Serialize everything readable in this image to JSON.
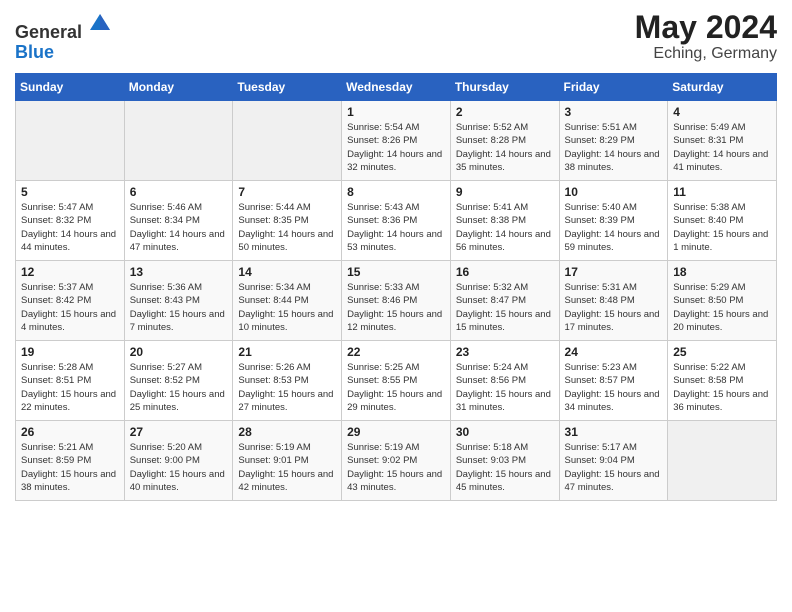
{
  "header": {
    "logo_general": "General",
    "logo_blue": "Blue",
    "month_year": "May 2024",
    "location": "Eching, Germany"
  },
  "days_of_week": [
    "Sunday",
    "Monday",
    "Tuesday",
    "Wednesday",
    "Thursday",
    "Friday",
    "Saturday"
  ],
  "weeks": [
    [
      {
        "day": "",
        "info": ""
      },
      {
        "day": "",
        "info": ""
      },
      {
        "day": "",
        "info": ""
      },
      {
        "day": "1",
        "info": "Sunrise: 5:54 AM\nSunset: 8:26 PM\nDaylight: 14 hours\nand 32 minutes."
      },
      {
        "day": "2",
        "info": "Sunrise: 5:52 AM\nSunset: 8:28 PM\nDaylight: 14 hours\nand 35 minutes."
      },
      {
        "day": "3",
        "info": "Sunrise: 5:51 AM\nSunset: 8:29 PM\nDaylight: 14 hours\nand 38 minutes."
      },
      {
        "day": "4",
        "info": "Sunrise: 5:49 AM\nSunset: 8:31 PM\nDaylight: 14 hours\nand 41 minutes."
      }
    ],
    [
      {
        "day": "5",
        "info": "Sunrise: 5:47 AM\nSunset: 8:32 PM\nDaylight: 14 hours\nand 44 minutes."
      },
      {
        "day": "6",
        "info": "Sunrise: 5:46 AM\nSunset: 8:34 PM\nDaylight: 14 hours\nand 47 minutes."
      },
      {
        "day": "7",
        "info": "Sunrise: 5:44 AM\nSunset: 8:35 PM\nDaylight: 14 hours\nand 50 minutes."
      },
      {
        "day": "8",
        "info": "Sunrise: 5:43 AM\nSunset: 8:36 PM\nDaylight: 14 hours\nand 53 minutes."
      },
      {
        "day": "9",
        "info": "Sunrise: 5:41 AM\nSunset: 8:38 PM\nDaylight: 14 hours\nand 56 minutes."
      },
      {
        "day": "10",
        "info": "Sunrise: 5:40 AM\nSunset: 8:39 PM\nDaylight: 14 hours\nand 59 minutes."
      },
      {
        "day": "11",
        "info": "Sunrise: 5:38 AM\nSunset: 8:40 PM\nDaylight: 15 hours\nand 1 minute."
      }
    ],
    [
      {
        "day": "12",
        "info": "Sunrise: 5:37 AM\nSunset: 8:42 PM\nDaylight: 15 hours\nand 4 minutes."
      },
      {
        "day": "13",
        "info": "Sunrise: 5:36 AM\nSunset: 8:43 PM\nDaylight: 15 hours\nand 7 minutes."
      },
      {
        "day": "14",
        "info": "Sunrise: 5:34 AM\nSunset: 8:44 PM\nDaylight: 15 hours\nand 10 minutes."
      },
      {
        "day": "15",
        "info": "Sunrise: 5:33 AM\nSunset: 8:46 PM\nDaylight: 15 hours\nand 12 minutes."
      },
      {
        "day": "16",
        "info": "Sunrise: 5:32 AM\nSunset: 8:47 PM\nDaylight: 15 hours\nand 15 minutes."
      },
      {
        "day": "17",
        "info": "Sunrise: 5:31 AM\nSunset: 8:48 PM\nDaylight: 15 hours\nand 17 minutes."
      },
      {
        "day": "18",
        "info": "Sunrise: 5:29 AM\nSunset: 8:50 PM\nDaylight: 15 hours\nand 20 minutes."
      }
    ],
    [
      {
        "day": "19",
        "info": "Sunrise: 5:28 AM\nSunset: 8:51 PM\nDaylight: 15 hours\nand 22 minutes."
      },
      {
        "day": "20",
        "info": "Sunrise: 5:27 AM\nSunset: 8:52 PM\nDaylight: 15 hours\nand 25 minutes."
      },
      {
        "day": "21",
        "info": "Sunrise: 5:26 AM\nSunset: 8:53 PM\nDaylight: 15 hours\nand 27 minutes."
      },
      {
        "day": "22",
        "info": "Sunrise: 5:25 AM\nSunset: 8:55 PM\nDaylight: 15 hours\nand 29 minutes."
      },
      {
        "day": "23",
        "info": "Sunrise: 5:24 AM\nSunset: 8:56 PM\nDaylight: 15 hours\nand 31 minutes."
      },
      {
        "day": "24",
        "info": "Sunrise: 5:23 AM\nSunset: 8:57 PM\nDaylight: 15 hours\nand 34 minutes."
      },
      {
        "day": "25",
        "info": "Sunrise: 5:22 AM\nSunset: 8:58 PM\nDaylight: 15 hours\nand 36 minutes."
      }
    ],
    [
      {
        "day": "26",
        "info": "Sunrise: 5:21 AM\nSunset: 8:59 PM\nDaylight: 15 hours\nand 38 minutes."
      },
      {
        "day": "27",
        "info": "Sunrise: 5:20 AM\nSunset: 9:00 PM\nDaylight: 15 hours\nand 40 minutes."
      },
      {
        "day": "28",
        "info": "Sunrise: 5:19 AM\nSunset: 9:01 PM\nDaylight: 15 hours\nand 42 minutes."
      },
      {
        "day": "29",
        "info": "Sunrise: 5:19 AM\nSunset: 9:02 PM\nDaylight: 15 hours\nand 43 minutes."
      },
      {
        "day": "30",
        "info": "Sunrise: 5:18 AM\nSunset: 9:03 PM\nDaylight: 15 hours\nand 45 minutes."
      },
      {
        "day": "31",
        "info": "Sunrise: 5:17 AM\nSunset: 9:04 PM\nDaylight: 15 hours\nand 47 minutes."
      },
      {
        "day": "",
        "info": ""
      }
    ]
  ]
}
